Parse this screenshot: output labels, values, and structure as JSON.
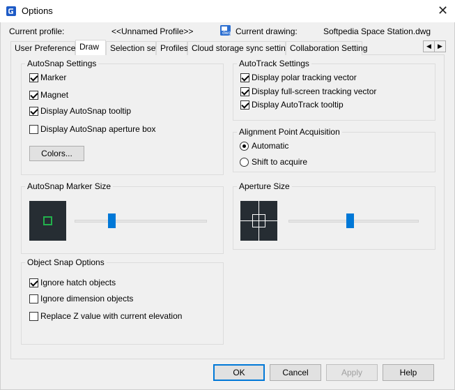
{
  "window": {
    "title": "Options",
    "close_glyph": "✕",
    "app_icon": "app-logo-icon",
    "close_icon": "close-icon"
  },
  "header": {
    "current_profile_label": "Current profile:",
    "current_profile_value": "<<Unnamed Profile>>",
    "current_drawing_label": "Current drawing:",
    "current_drawing_value": "Softpedia Space Station.dwg",
    "drawing_icon": "drawing-file-icon"
  },
  "tabs": [
    {
      "label": "User Preferences"
    },
    {
      "label": "Draw"
    },
    {
      "label": "Selection set"
    },
    {
      "label": "Profiles"
    },
    {
      "label": "Cloud storage sync settings"
    },
    {
      "label": "Collaboration Setting"
    }
  ],
  "active_tab": "Draw",
  "tab_scroll": {
    "left_glyph": "◀",
    "right_glyph": "▶",
    "left_icon": "scroll-left-icon",
    "right_icon": "scroll-right-icon"
  },
  "autosnap": {
    "title": "AutoSnap Settings",
    "options": [
      {
        "label": "Marker",
        "checked": true
      },
      {
        "label": "Magnet",
        "checked": true
      },
      {
        "label": "Display AutoSnap tooltip",
        "checked": true
      },
      {
        "label": "Display AutoSnap aperture box",
        "checked": false
      }
    ],
    "colors_button": "Colors..."
  },
  "autotrack": {
    "title": "AutoTrack Settings",
    "options": [
      {
        "label": "Display polar tracking vector",
        "checked": true
      },
      {
        "label": "Display full-screen tracking vector",
        "checked": true
      },
      {
        "label": "Display AutoTrack tooltip",
        "checked": true
      }
    ]
  },
  "alignment": {
    "title": "Alignment Point Acquisition",
    "options": [
      {
        "label": "Automatic",
        "selected": true
      },
      {
        "label": "Shift to acquire",
        "selected": false
      }
    ]
  },
  "marker_size": {
    "title": "AutoSnap Marker Size",
    "slider_fraction": 0.27,
    "preview_icon": "marker-preview-icon"
  },
  "aperture_size": {
    "title": "Aperture Size",
    "slider_fraction": 0.47,
    "preview_icon": "aperture-preview-icon"
  },
  "object_snap": {
    "title": "Object Snap Options",
    "options": [
      {
        "label": "Ignore hatch objects",
        "checked": true
      },
      {
        "label": "Ignore dimension objects",
        "checked": false
      },
      {
        "label": "Replace Z value with current elevation",
        "checked": false
      }
    ]
  },
  "footer": {
    "ok": "OK",
    "cancel": "Cancel",
    "apply": "Apply",
    "help": "Help",
    "apply_enabled": false
  },
  "colors": {
    "accent": "#0078d7",
    "preview_bg": "#262d33",
    "marker_green": "#22b14c"
  }
}
